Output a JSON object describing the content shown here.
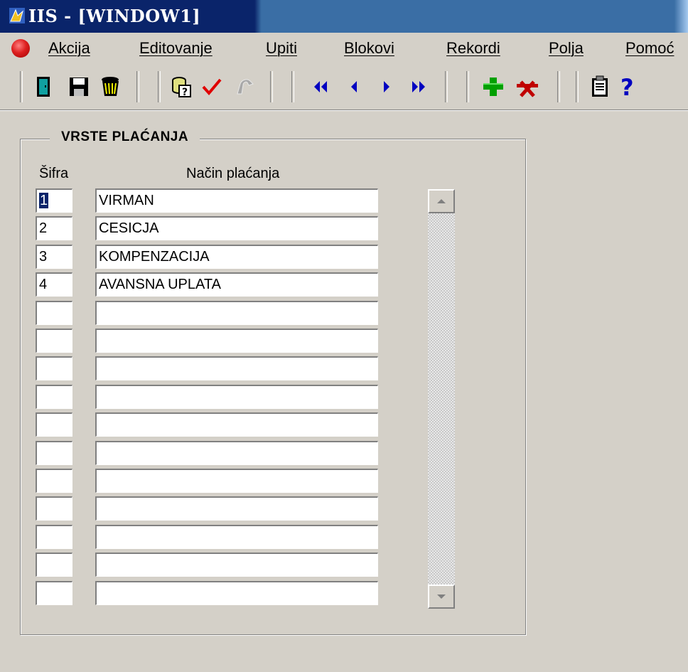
{
  "window": {
    "title": "IIS  - [WINDOW1]"
  },
  "menu": [
    {
      "label": "Akcija"
    },
    {
      "label": "Editovanje"
    },
    {
      "label": "Upiti"
    },
    {
      "label": "Blokovi"
    },
    {
      "label": "Rekordi"
    },
    {
      "label": "Polja"
    },
    {
      "label": "Pomoć"
    }
  ],
  "toolbar": {
    "buttons": [
      "exit-icon",
      "save-icon",
      "trash-icon",
      "query-icon",
      "checkmark-icon",
      "undo-icon",
      "first-record-icon",
      "previous-record-icon",
      "next-record-icon",
      "last-record-icon",
      "insert-record-icon",
      "delete-record-icon",
      "clipboard-icon",
      "help-icon"
    ]
  },
  "block": {
    "title": "VRSTE PLAĆANJA",
    "columns": {
      "sifra": "Šifra",
      "nacin": "Način plaćanja"
    },
    "rows": [
      {
        "sifra": "1",
        "nacin": "VIRMAN"
      },
      {
        "sifra": "2",
        "nacin": "CESICJA"
      },
      {
        "sifra": "3",
        "nacin": "KOMPENZACIJA"
      },
      {
        "sifra": "4",
        "nacin": "AVANSNA UPLATA"
      },
      {
        "sifra": "",
        "nacin": ""
      },
      {
        "sifra": "",
        "nacin": ""
      },
      {
        "sifra": "",
        "nacin": ""
      },
      {
        "sifra": "",
        "nacin": ""
      },
      {
        "sifra": "",
        "nacin": ""
      },
      {
        "sifra": "",
        "nacin": ""
      },
      {
        "sifra": "",
        "nacin": ""
      },
      {
        "sifra": "",
        "nacin": ""
      },
      {
        "sifra": "",
        "nacin": ""
      },
      {
        "sifra": "",
        "nacin": ""
      },
      {
        "sifra": "",
        "nacin": ""
      }
    ]
  },
  "colors": {
    "titlebar": "#0a246a",
    "background": "#d4d0c8",
    "selection": "#0a246a"
  }
}
